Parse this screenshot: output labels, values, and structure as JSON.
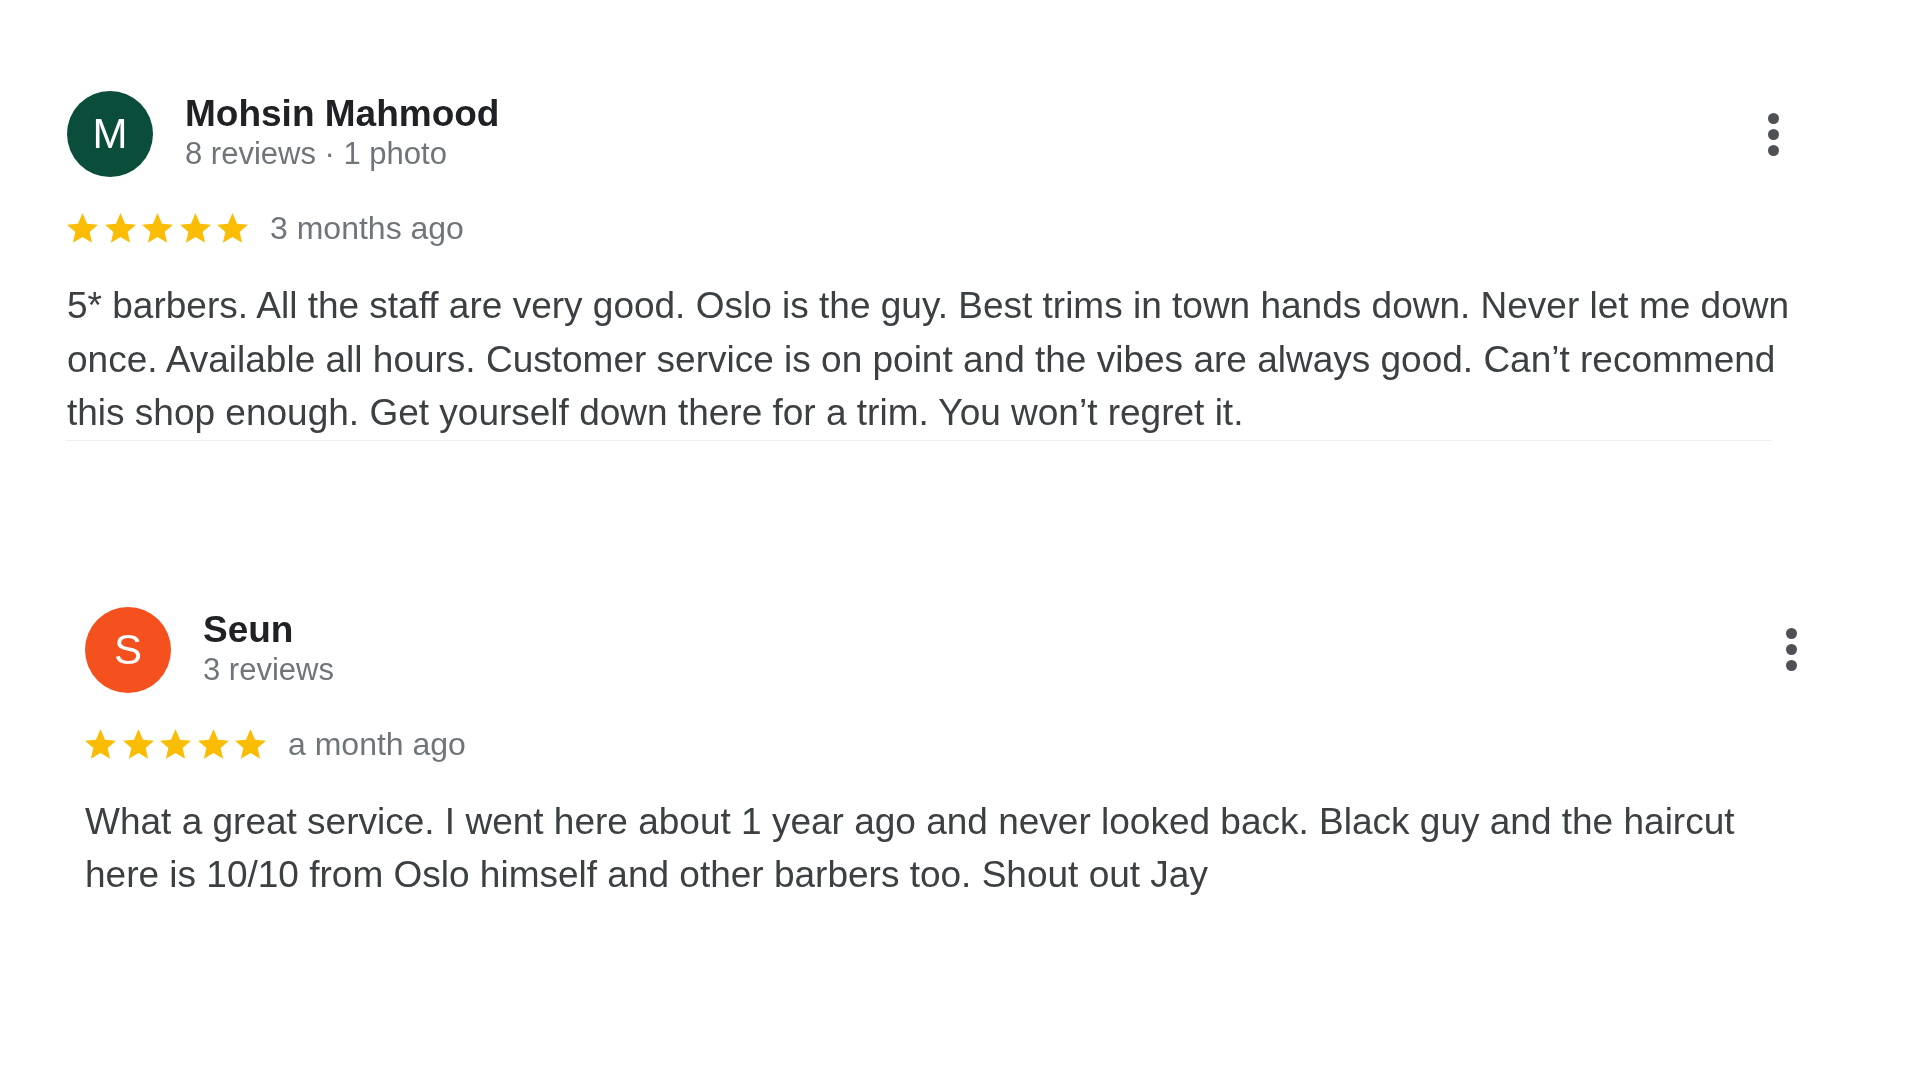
{
  "reviews": [
    {
      "initial": "M",
      "color": "#0b4d3b",
      "name": "Mohsin Mahmood",
      "stats": "8 reviews · 1 photo",
      "stars": 5,
      "time": "3 months ago",
      "text": "5* barbers. All the staff are very good. Oslo is the guy. Best trims in town hands down. Never let me down once. Available all hours. Customer service is on point and the vibes are always good. Can’t recommend this shop enough. Get yourself down there for a trim. You won’t regret it."
    },
    {
      "initial": "S",
      "color": "#f4511e",
      "name": "Seun",
      "stats": "3 reviews",
      "stars": 5,
      "time": "a month ago",
      "text": "What a great service. I went here about 1 year ago and never looked back. Black guy and the haircut here is 10/10 from Oslo himself and other barbers too. Shout out Jay"
    }
  ]
}
